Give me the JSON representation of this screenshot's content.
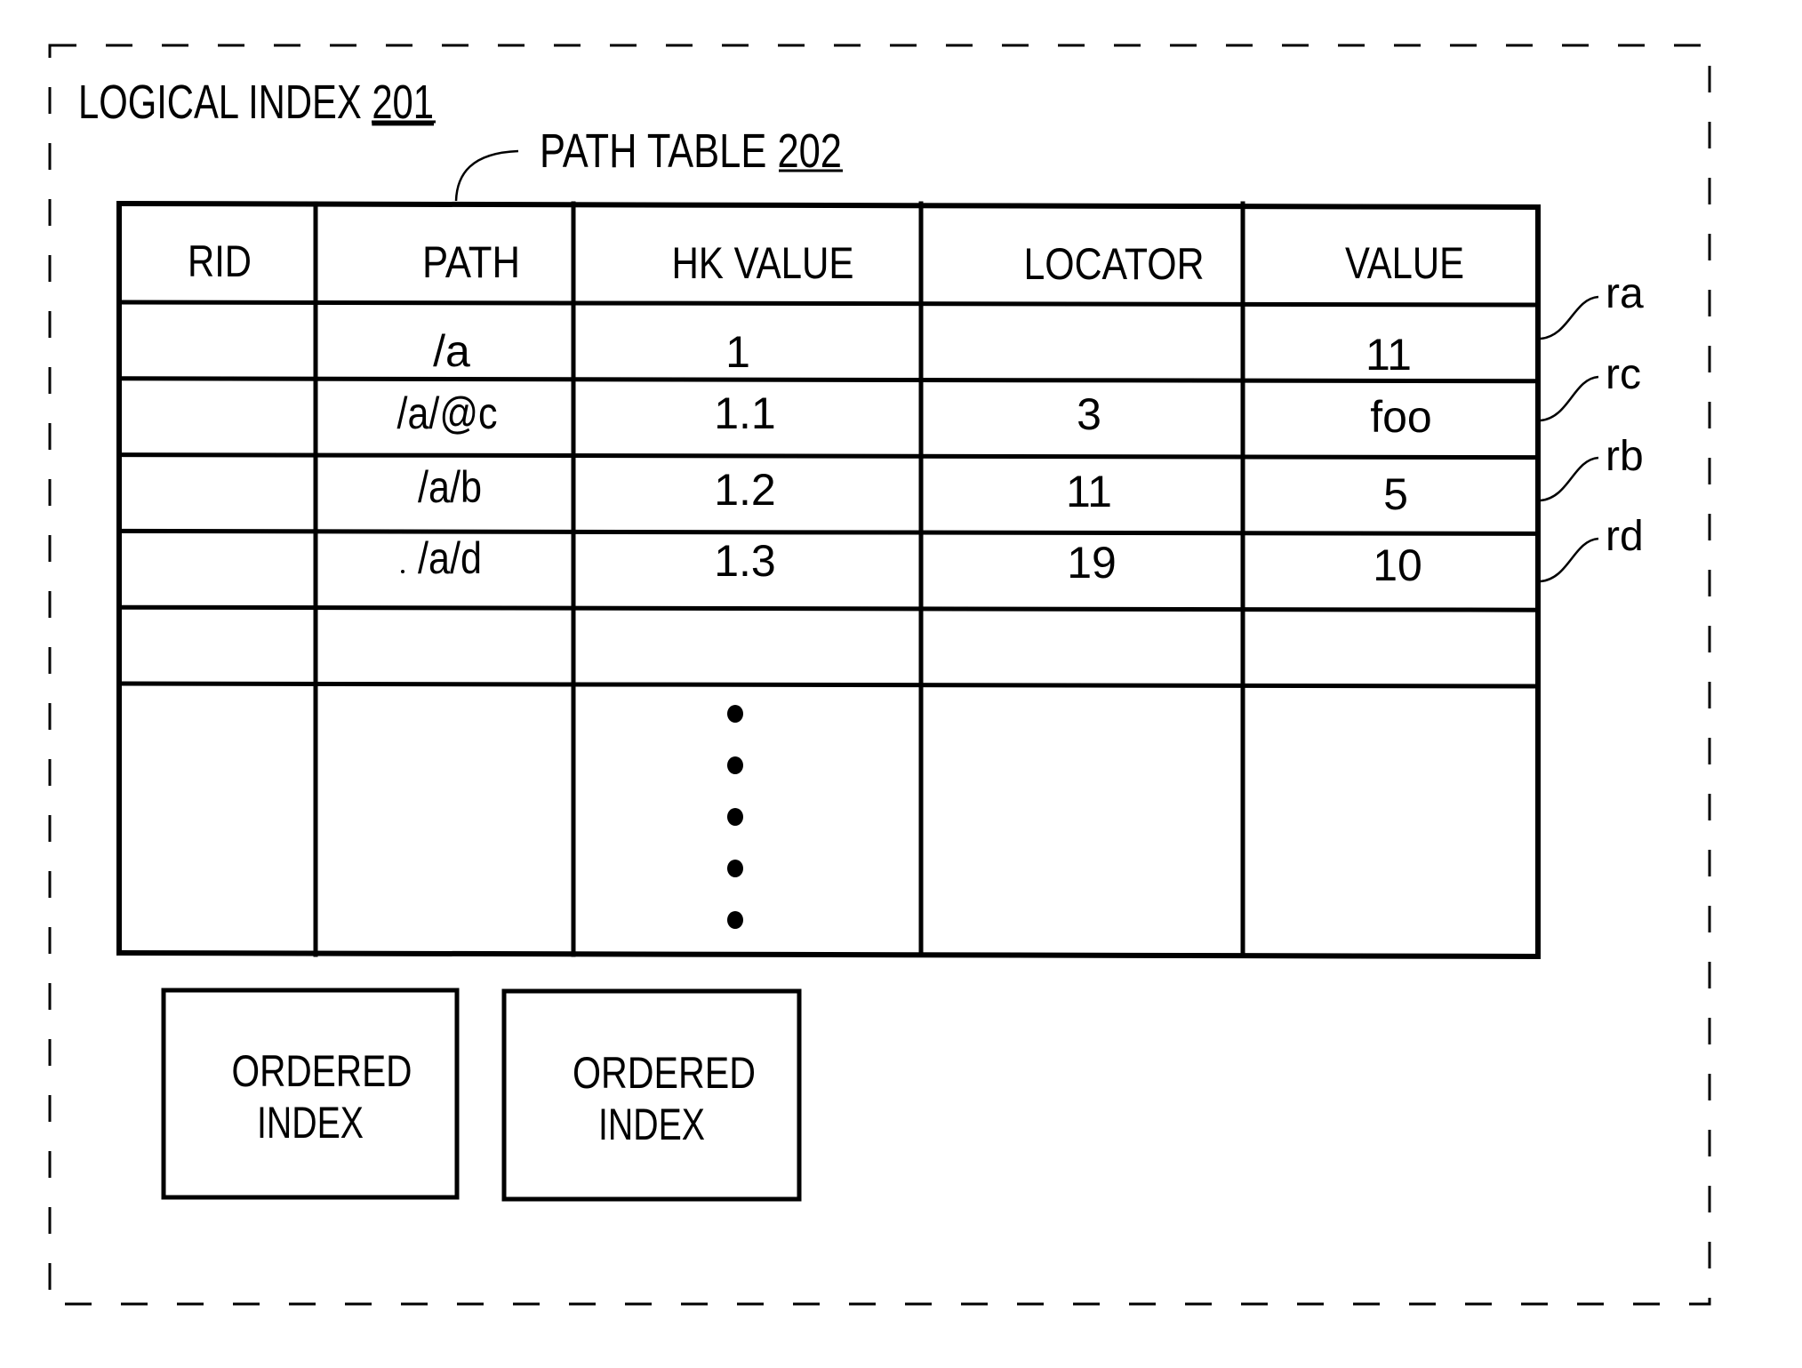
{
  "title": {
    "text": "LOGICAL INDEX ",
    "ref": "201"
  },
  "path_table": {
    "label": "PATH TABLE ",
    "ref": "202",
    "columns": [
      "RID",
      "PATH",
      "HK VALUE",
      "LOCATOR",
      "VALUE"
    ],
    "rows": [
      {
        "rid": "",
        "path": "/a",
        "hk_value": "1",
        "locator": "",
        "value": "11",
        "row_label": "ra"
      },
      {
        "rid": "",
        "path": "/a/@c",
        "hk_value": "1.1",
        "locator": "3",
        "value": "foo",
        "row_label": "rc"
      },
      {
        "rid": "",
        "path": "/a/b",
        "hk_value": "1.2",
        "locator": "11",
        "value": "5",
        "row_label": "rb"
      },
      {
        "rid": "",
        "path": "/a/d",
        "hk_value": "1.3",
        "locator": "19",
        "value": "10",
        "row_label": "rd"
      }
    ],
    "empty_rows_after": 1,
    "continuation": "ellipsis-vertical-dots",
    "continuation_dot_count": 5
  },
  "ordered_indexes": [
    {
      "line1": "ORDERED",
      "line2": "INDEX"
    },
    {
      "line1": "ORDERED",
      "line2": "INDEX"
    }
  ],
  "colors": {
    "ink": "#000000",
    "background": "#ffffff"
  }
}
